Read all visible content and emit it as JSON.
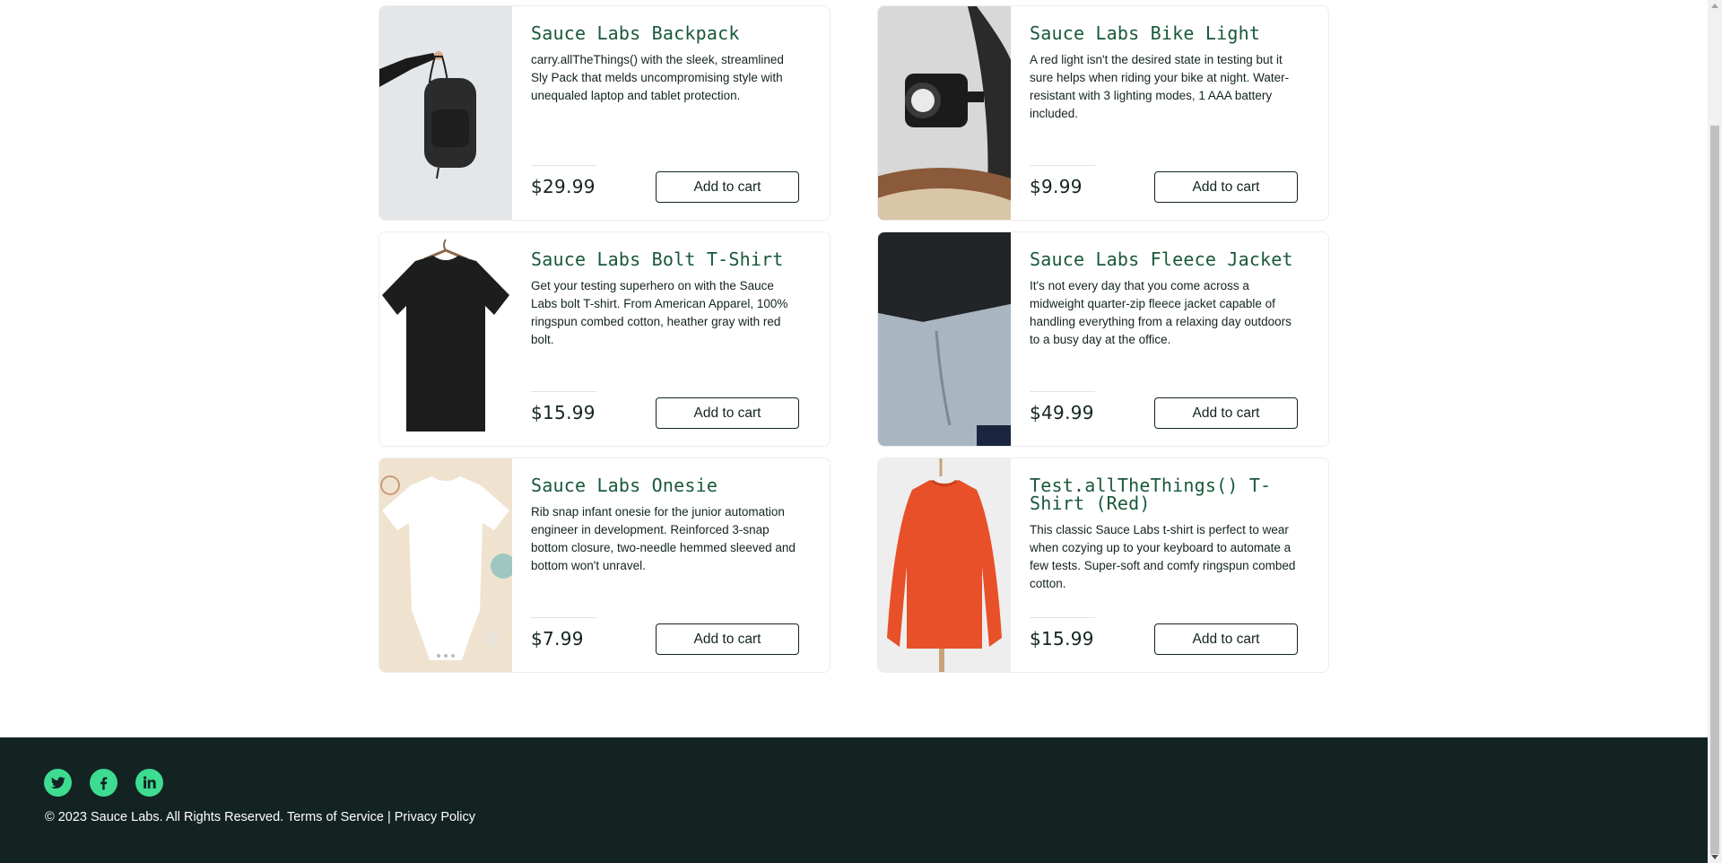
{
  "products": [
    {
      "name": "Sauce Labs Backpack",
      "description": "carry.allTheThings() with the sleek, streamlined Sly Pack that melds uncompromising style with unequaled laptop and tablet protection.",
      "price": "$29.99",
      "button_label": "Add to cart",
      "image_icon": "backpack-image"
    },
    {
      "name": "Sauce Labs Bike Light",
      "description": "A red light isn't the desired state in testing but it sure helps when riding your bike at night. Water-resistant with 3 lighting modes, 1 AAA battery included.",
      "price": "$9.99",
      "button_label": "Add to cart",
      "image_icon": "bike-light-image"
    },
    {
      "name": "Sauce Labs Bolt T-Shirt",
      "description": "Get your testing superhero on with the Sauce Labs bolt T-shirt. From American Apparel, 100% ringspun combed cotton, heather gray with red bolt.",
      "price": "$15.99",
      "button_label": "Add to cart",
      "image_icon": "tshirt-image"
    },
    {
      "name": "Sauce Labs Fleece Jacket",
      "description": "It's not every day that you come across a midweight quarter-zip fleece jacket capable of handling everything from a relaxing day outdoors to a busy day at the office.",
      "price": "$49.99",
      "button_label": "Add to cart",
      "image_icon": "fleece-jacket-image"
    },
    {
      "name": "Sauce Labs Onesie",
      "description": "Rib snap infant onesie for the junior automation engineer in development. Reinforced 3-snap bottom closure, two-needle hemmed sleeved and bottom won't unravel.",
      "price": "$7.99",
      "button_label": "Add to cart",
      "image_icon": "onesie-image"
    },
    {
      "name": "Test.allTheThings() T-Shirt (Red)",
      "description": "This classic Sauce Labs t-shirt is perfect to wear when cozying up to your keyboard to automate a few tests. Super-soft and comfy ringspun combed cotton.",
      "price": "$15.99",
      "button_label": "Add to cart",
      "image_icon": "red-sweatshirt-image"
    }
  ],
  "footer": {
    "social": [
      {
        "name": "twitter-icon"
      },
      {
        "name": "facebook-icon"
      },
      {
        "name": "linkedin-icon"
      }
    ],
    "copyright": "© 2023 Sauce Labs. All Rights Reserved. Terms of Service | Privacy Policy"
  },
  "colors": {
    "title_green": "#18583a",
    "text_dark": "#132322",
    "footer_bg": "#132322",
    "social_green": "#3ddc91"
  }
}
